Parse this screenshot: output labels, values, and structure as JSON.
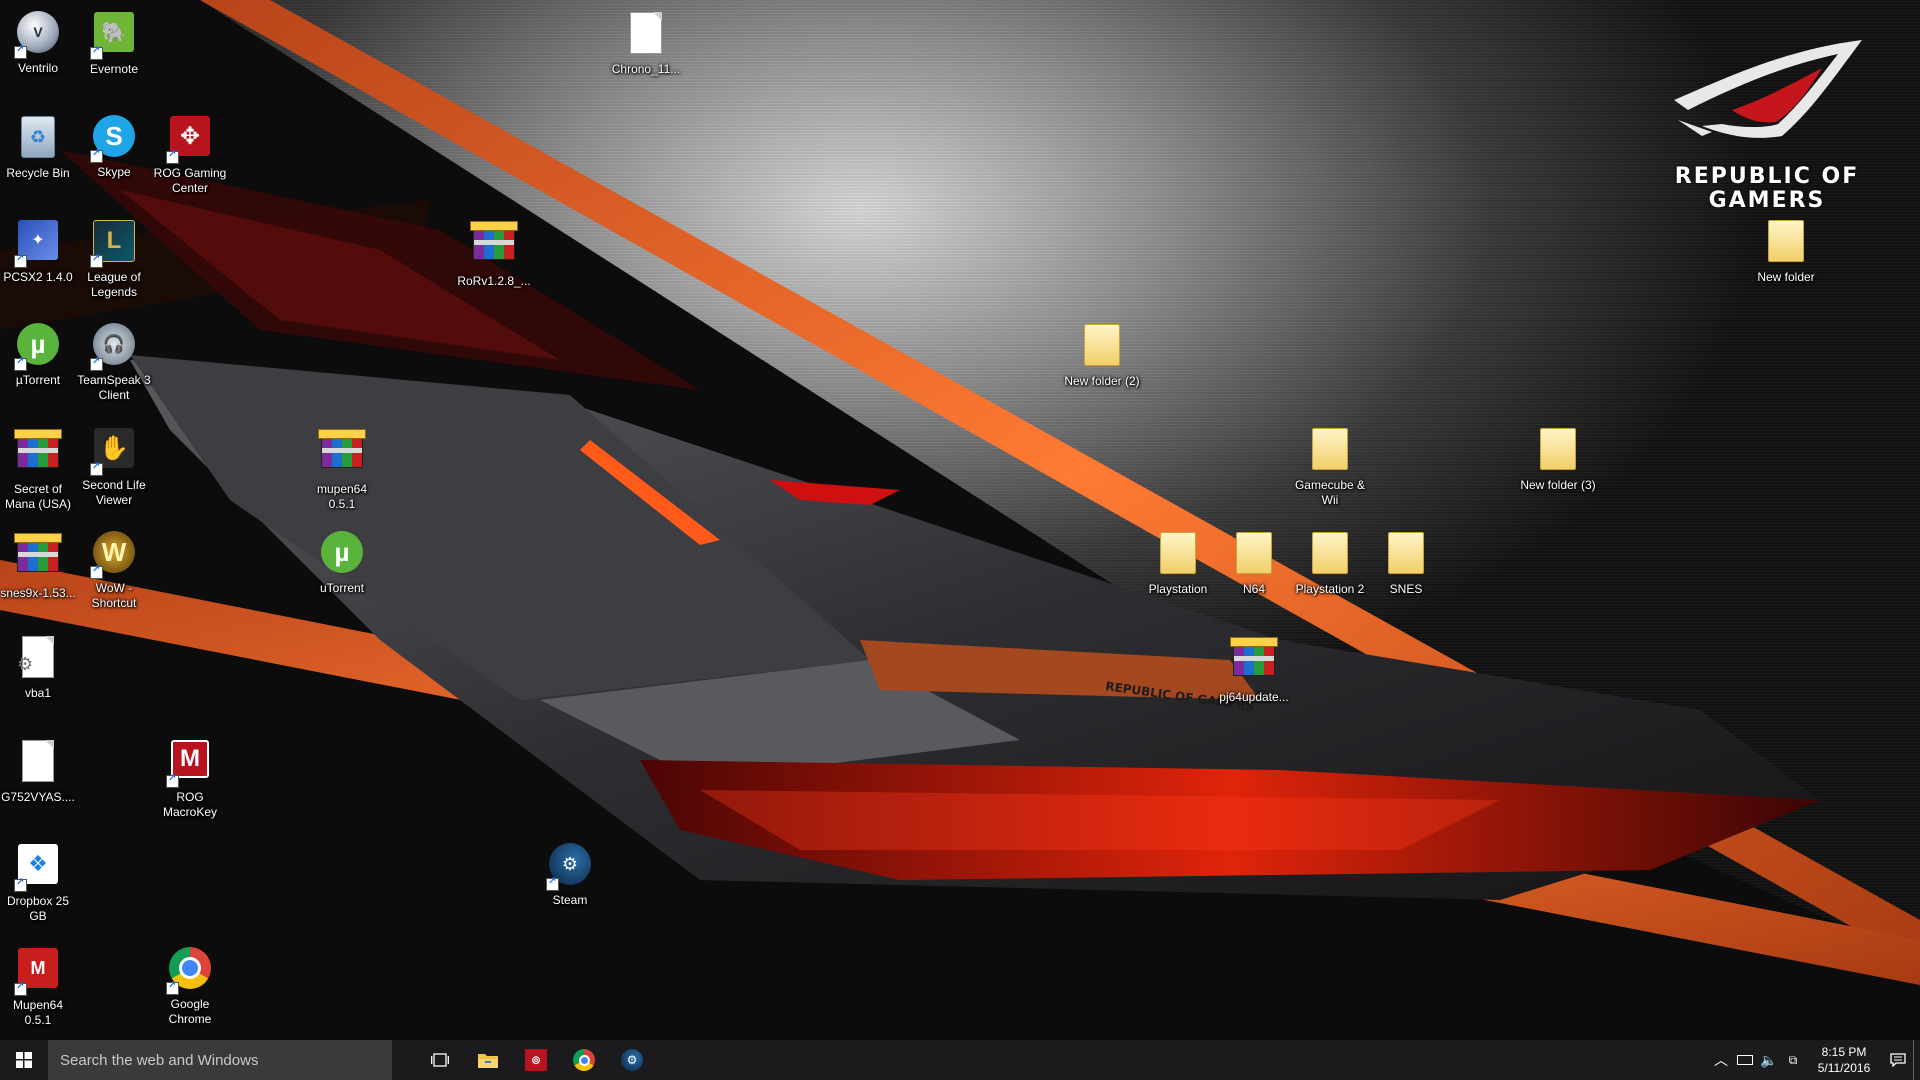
{
  "desktop": {
    "icons": [
      {
        "label": "Ventrilo"
      },
      {
        "label": "Evernote"
      },
      {
        "label": "Chrono_11..."
      },
      {
        "label": "Recycle Bin"
      },
      {
        "label": "Skype"
      },
      {
        "label": "ROG Gaming Center"
      },
      {
        "label": "PCSX2 1.4.0"
      },
      {
        "label": "League of Legends"
      },
      {
        "label": "RoRv1.2.8_..."
      },
      {
        "label": "µTorrent"
      },
      {
        "label": "TeamSpeak 3 Client"
      },
      {
        "label": "New folder (2)"
      },
      {
        "label": "Secret of Mana (USA)"
      },
      {
        "label": "Second Life Viewer"
      },
      {
        "label": "mupen64 0.5.1"
      },
      {
        "label": "Gamecube & Wii"
      },
      {
        "label": "New folder (3)"
      },
      {
        "label": "snes9x-1.53..."
      },
      {
        "label": "WoW - Shortcut"
      },
      {
        "label": "uTorrent"
      },
      {
        "label": "Playstation"
      },
      {
        "label": "N64"
      },
      {
        "label": "Playstation 2"
      },
      {
        "label": "SNES"
      },
      {
        "label": "vba1"
      },
      {
        "label": "pj64update..."
      },
      {
        "label": "G752VYAS...."
      },
      {
        "label": "ROG MacroKey"
      },
      {
        "label": "Dropbox 25 GB"
      },
      {
        "label": "Steam"
      },
      {
        "label": "Mupen64 0.5.1"
      },
      {
        "label": "Google Chrome"
      },
      {
        "label": "New folder"
      }
    ]
  },
  "wallpaper": {
    "logo_text_line1": "REPUBLIC OF",
    "logo_text_line2": "GAMERS",
    "laptop_text": "REPUBLIC OF GAMERS"
  },
  "taskbar": {
    "search_placeholder": "Search the web and Windows",
    "pinned": [
      "task-view",
      "file-explorer",
      "rog-app",
      "google-chrome",
      "steam"
    ],
    "tray": {
      "time": "8:15 PM",
      "date": "5/11/2016"
    }
  },
  "colors": {
    "accent_orange": "#e0581c",
    "rog_red": "#c4161c",
    "taskbar_bg": "#1b1b1d"
  }
}
